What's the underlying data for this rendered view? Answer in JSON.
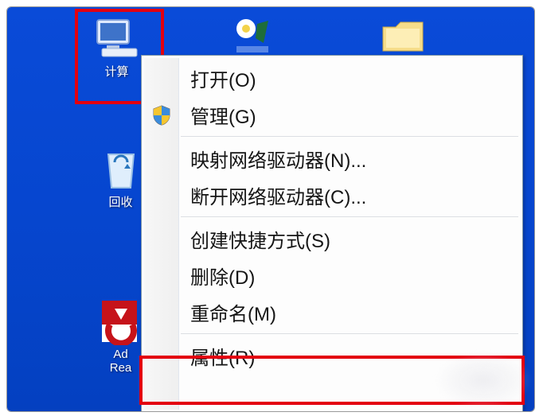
{
  "desktop": {
    "icons": {
      "computer": {
        "label": "计算"
      },
      "recycle": {
        "label": "回收"
      },
      "adobe": {
        "label_line1": "Ad",
        "label_line2": "Rea"
      }
    }
  },
  "context_menu": {
    "items": [
      {
        "label": "打开(O)",
        "has_shield": false
      },
      {
        "label": "管理(G)",
        "has_shield": true
      }
    ],
    "group2": [
      {
        "label": "映射网络驱动器(N)..."
      },
      {
        "label": "断开网络驱动器(C)..."
      }
    ],
    "group3": [
      {
        "label": "创建快捷方式(S)"
      },
      {
        "label": "删除(D)"
      },
      {
        "label": "重命名(M)"
      }
    ],
    "group4": [
      {
        "label": "属性(R)"
      }
    ]
  }
}
